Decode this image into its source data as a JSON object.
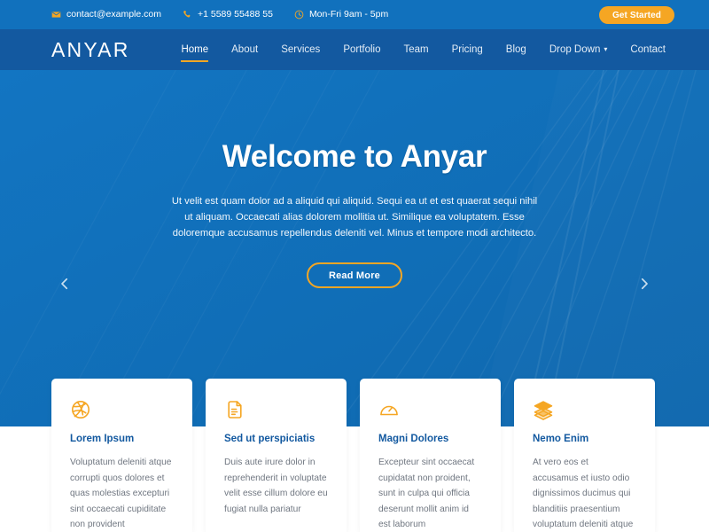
{
  "topbar": {
    "contacts": [
      {
        "icon": "envelope-icon",
        "text": "contact@example.com"
      },
      {
        "icon": "phone-icon",
        "text": "+1 5589 55488 55"
      },
      {
        "icon": "clock-icon",
        "text": "Mon-Fri 9am - 5pm"
      }
    ],
    "cta_label": "Get Started",
    "bg_color": "#1171bd",
    "accent_color": "#f5a623"
  },
  "navbar": {
    "logo": "ANYAR",
    "bg_color": "#1359a0",
    "items": [
      {
        "label": "Home",
        "active": true,
        "has_dropdown": false
      },
      {
        "label": "About",
        "active": false,
        "has_dropdown": false
      },
      {
        "label": "Services",
        "active": false,
        "has_dropdown": false
      },
      {
        "label": "Portfolio",
        "active": false,
        "has_dropdown": false
      },
      {
        "label": "Team",
        "active": false,
        "has_dropdown": false
      },
      {
        "label": "Pricing",
        "active": false,
        "has_dropdown": false
      },
      {
        "label": "Blog",
        "active": false,
        "has_dropdown": false
      },
      {
        "label": "Drop Down",
        "active": false,
        "has_dropdown": true
      },
      {
        "label": "Contact",
        "active": false,
        "has_dropdown": false
      }
    ]
  },
  "hero": {
    "title": "Welcome to Anyar",
    "text": "Ut velit est quam dolor ad a aliquid qui aliquid. Sequi ea ut et est quaerat sequi nihil ut aliquam. Occaecati alias dolorem mollitia ut. Similique ea voluptatem. Esse doloremque accusamus repellendus deleniti vel. Minus et tempore modi architecto.",
    "button_label": "Read More",
    "bg_color": "#1171bd",
    "prev_icon": "chevron-left-icon",
    "next_icon": "chevron-right-icon"
  },
  "cards": [
    {
      "icon": "dribbble-icon",
      "title": "Lorem Ipsum",
      "text": "Voluptatum deleniti atque corrupti quos dolores et quas molestias excepturi sint occaecati cupiditate non provident"
    },
    {
      "icon": "file-document-icon",
      "title": "Sed ut perspiciatis",
      "text": "Duis aute irure dolor in reprehenderit in voluptate velit esse cillum dolore eu fugiat nulla pariatur"
    },
    {
      "icon": "gauge-icon",
      "title": "Magni Dolores",
      "text": "Excepteur sint occaecat cupidatat non proident, sunt in culpa qui officia deserunt mollit anim id est laborum"
    },
    {
      "icon": "layers-icon",
      "title": "Nemo Enim",
      "text": "At vero eos et accusamus et iusto odio dignissimos ducimus qui blanditiis praesentium voluptatum deleniti atque"
    }
  ]
}
